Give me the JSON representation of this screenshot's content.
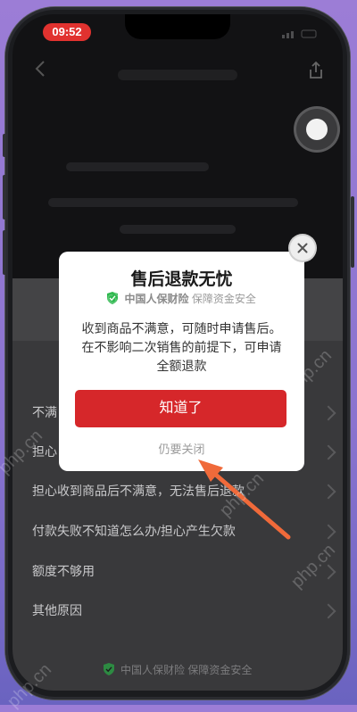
{
  "status_bar": {
    "time": "09:52"
  },
  "modal": {
    "title": "售后退款无忧",
    "badge_brand": "中国人保财险",
    "badge_text": "保障资金安全",
    "body": "收到商品不满意，可随时申请售后。在不影响二次销售的前提下，可申请全额退款",
    "confirm_label": "知道了",
    "close_label": "仍要关闭"
  },
  "reasons": {
    "items": [
      "不满",
      "担心",
      "担心收到商品后不满意，无法售后退款",
      "付款失败不知道怎么办/担心产生欠款",
      "额度不够用",
      "其他原因"
    ]
  },
  "footer": {
    "brand": "中国人保财险",
    "text": "保障资金安全"
  },
  "watermark": {
    "text": "php.cn"
  },
  "colors": {
    "accent_red": "#d6272a",
    "shield_green": "#2db84d",
    "arrow_orange": "#f06a3a",
    "time_pill": "#e1322f"
  }
}
